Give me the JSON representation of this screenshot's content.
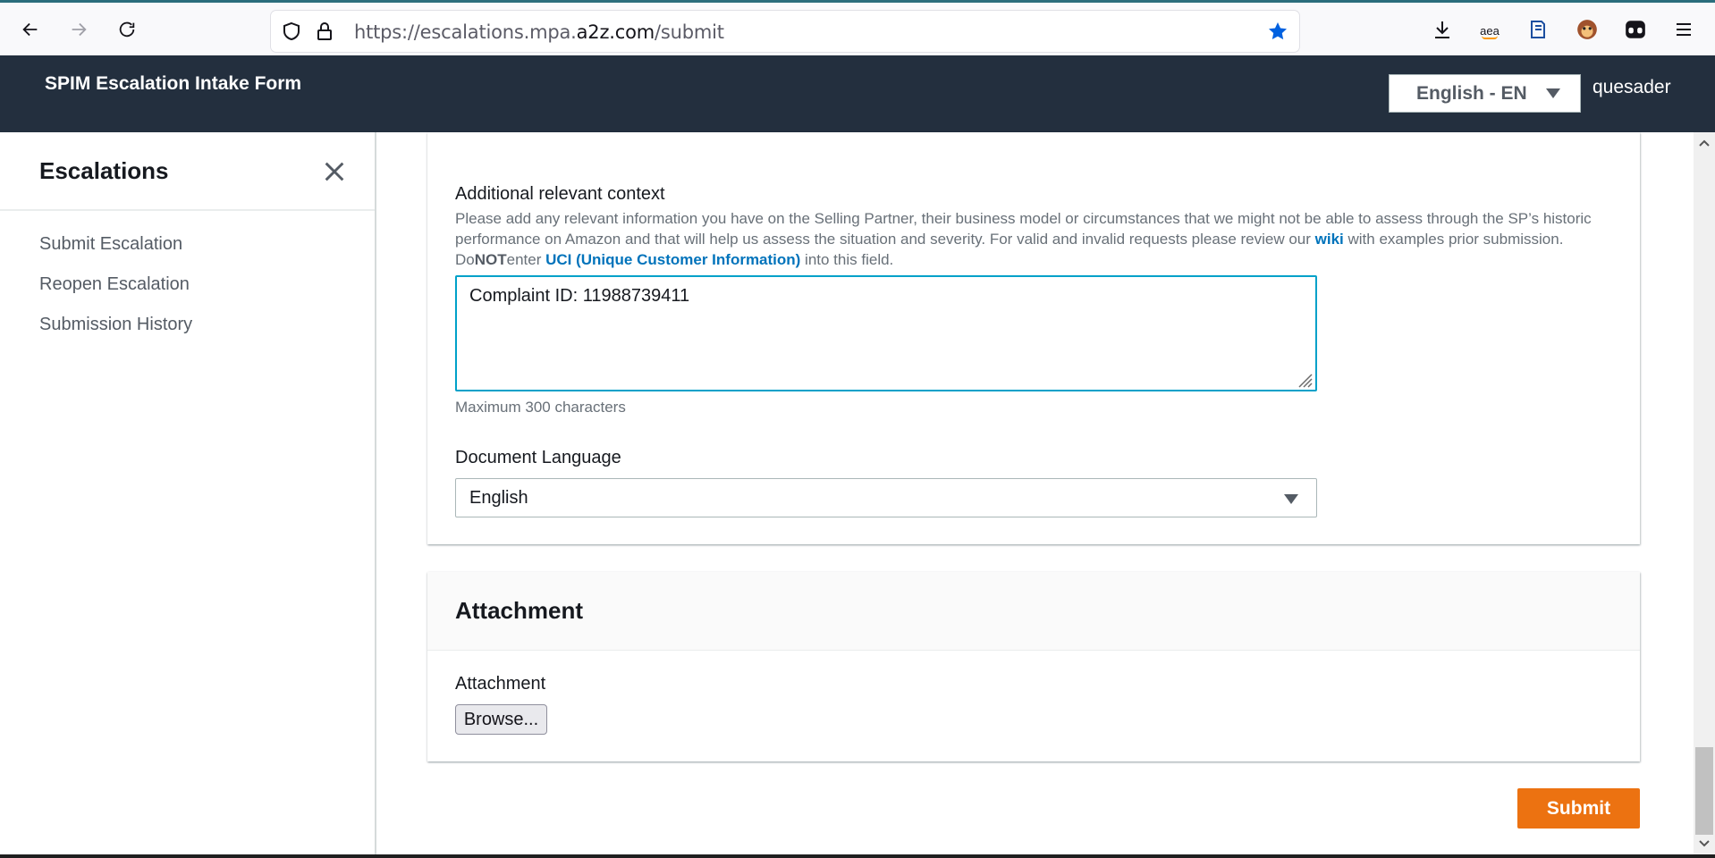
{
  "browser": {
    "url_prefix": "https://escalations.mpa.",
    "url_domain": "a2z.com",
    "url_path": "/submit",
    "amazon_ext_label": "aea"
  },
  "header": {
    "title": "SPIM Escalation Intake Form",
    "language": "English - EN",
    "user": "quesader"
  },
  "sidebar": {
    "title": "Escalations",
    "items": [
      {
        "label": "Submit Escalation"
      },
      {
        "label": "Reopen Escalation"
      },
      {
        "label": "Submission History"
      }
    ]
  },
  "form": {
    "context_label": "Additional relevant context",
    "context_desc_part1": "Please add any relevant information you have on the Selling Partner, their business model or circumstances that we might not be able to assess through the SP’s historic performance on Amazon and that will help us assess the situation and severity. For valid and invalid requests please review our ",
    "context_desc_link": "wiki",
    "context_desc_part2": " with examples prior submission. Do",
    "context_desc_not": "NOT",
    "context_desc_part3": "enter ",
    "context_desc_uci": "UCI (Unique Customer Information)",
    "context_desc_part4": " into this field.",
    "context_value": "Complaint ID: 11988739411",
    "context_hint": "Maximum 300 characters",
    "doc_lang_label": "Document Language",
    "doc_lang_value": "English"
  },
  "attachment": {
    "section_title": "Attachment",
    "field_label": "Attachment",
    "browse_label": "Browse..."
  },
  "actions": {
    "submit_label": "Submit"
  },
  "colors": {
    "header_bg": "#232f3e",
    "accent": "#ec7211",
    "link": "#0073bb",
    "focus": "#00a1c9"
  }
}
